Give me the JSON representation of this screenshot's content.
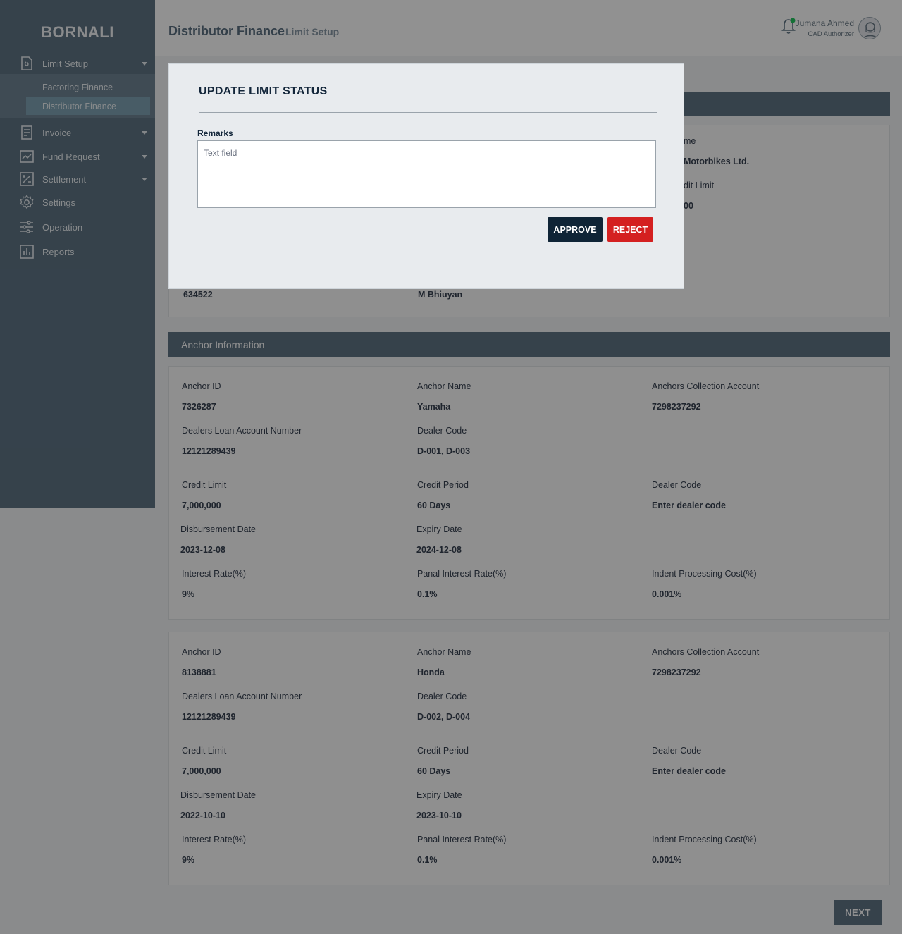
{
  "sidebar": {
    "brand": "BORNALI",
    "items": [
      {
        "label": "Limit Setup",
        "icon": "file-icon"
      },
      {
        "label": "Invoice",
        "icon": "receipt-icon"
      },
      {
        "label": "Fund Request",
        "icon": "trend-chart-icon"
      },
      {
        "label": "Settlement",
        "icon": "percent-icon"
      },
      {
        "label": "Settings",
        "icon": "gear-icon"
      },
      {
        "label": "Operation",
        "icon": "sliders-icon"
      },
      {
        "label": "Reports",
        "icon": "bar-chart-icon"
      }
    ],
    "sub_items": [
      {
        "label": "Factoring Finance"
      },
      {
        "label": "Distributor Finance"
      }
    ]
  },
  "header": {
    "title": "Distributor Finance",
    "subtitle": "Limit Setup",
    "user_name": "Jumana Ahmed",
    "user_role": "CAD Authorizer"
  },
  "partial": {
    "name_label_fragment": "me",
    "name_value_fragment": "Motorbikes Ltd.",
    "limit_label_fragment": "dit Limit",
    "limit_value_fragment": "00",
    "value_left": "634522",
    "value_mid": "M Bhiuyan"
  },
  "anchor_section": {
    "title": "Anchor Information"
  },
  "anchors": [
    {
      "anchor_id_label": "Anchor ID",
      "anchor_id": "7326287",
      "anchor_name_label": "Anchor Name",
      "anchor_name": "Yamaha",
      "collection_label": "Anchors Collection Account",
      "collection": "7298237292",
      "loan_label": "Dealers Loan Account Number",
      "loan": "12121289439",
      "dealer_code_label": "Dealer Code",
      "dealer_code": "D-001, D-003",
      "credit_limit_label": "Credit Limit",
      "credit_limit": "7,000,000",
      "credit_period_label": "Credit Period",
      "credit_period": "60 Days",
      "dealer_code2_label": "Dealer Code",
      "dealer_code2": "Enter dealer code",
      "disb_label": "Disbursement Date",
      "disb": "2023-12-08",
      "expiry_label": "Expiry Date",
      "expiry": "2024-12-08",
      "interest_label": "Interest Rate(%)",
      "interest": "9%",
      "panal_label": "Panal Interest Rate(%)",
      "panal": "0.1%",
      "indent_label": "Indent Processing Cost(%)",
      "indent": "0.001%"
    },
    {
      "anchor_id_label": "Anchor ID",
      "anchor_id": "8138881",
      "anchor_name_label": "Anchor Name",
      "anchor_name": "Honda",
      "collection_label": "Anchors Collection Account",
      "collection": "7298237292",
      "loan_label": "Dealers Loan Account Number",
      "loan": "12121289439",
      "dealer_code_label": "Dealer Code",
      "dealer_code": "D-002, D-004",
      "credit_limit_label": "Credit Limit",
      "credit_limit": "7,000,000",
      "credit_period_label": "Credit Period",
      "credit_period": "60 Days",
      "dealer_code2_label": "Dealer Code",
      "dealer_code2": "Enter dealer code",
      "disb_label": "Disbursement Date",
      "disb": "2022-10-10",
      "expiry_label": "Expiry Date",
      "expiry": "2023-10-10",
      "interest_label": "Interest Rate(%)",
      "interest": "9%",
      "panal_label": "Panal Interest Rate(%)",
      "panal": "0.1%",
      "indent_label": "Indent Processing Cost(%)",
      "indent": "0.001%"
    }
  ],
  "next_label": "NEXT",
  "modal": {
    "title": "UPDATE LIMIT STATUS",
    "remarks_label": "Remarks",
    "remarks_placeholder": "Text field",
    "remarks_value": "",
    "approve_label": "APPROVE",
    "reject_label": "REJECT"
  },
  "colors": {
    "sidebar": "#5f7485",
    "approve": "#0f2436",
    "reject": "#d42020",
    "notification_dot": "#22c55e"
  }
}
